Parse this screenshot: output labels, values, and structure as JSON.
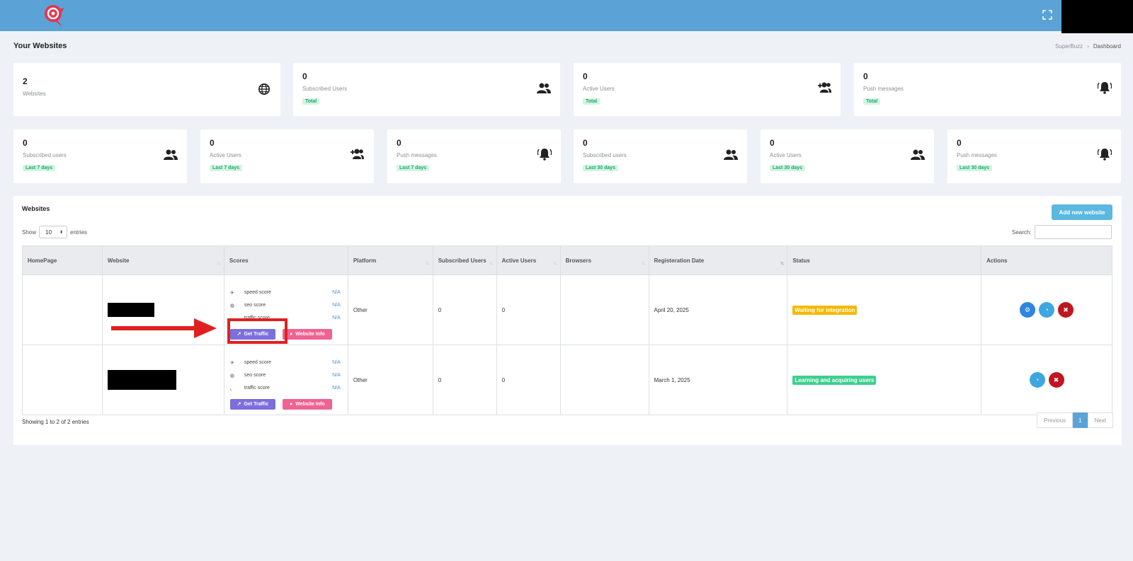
{
  "page": {
    "title": "Your Websites",
    "breadcrumb": [
      "SuperBuzz",
      "Dashboard"
    ]
  },
  "top_cards": [
    {
      "value": "2",
      "label": "Websites",
      "tag": "",
      "icon": "globe-icon"
    },
    {
      "value": "0",
      "label": "Subscribed Users",
      "tag": "Total",
      "icon": "users-icon"
    },
    {
      "value": "0",
      "label": "Active Users",
      "tag": "Total",
      "icon": "user-plus-icon"
    },
    {
      "value": "0",
      "label": "Push messages",
      "tag": "Total",
      "icon": "bell-icon"
    }
  ],
  "period_cards": [
    {
      "value": "0",
      "label": "Subscribed users",
      "tag": "Last 7 days",
      "icon": "users-icon"
    },
    {
      "value": "0",
      "label": "Active Users",
      "tag": "Last 7 days",
      "icon": "user-plus-icon"
    },
    {
      "value": "0",
      "label": "Push messages",
      "tag": "Last 7 days",
      "icon": "bell-icon"
    },
    {
      "value": "0",
      "label": "Subscribed users",
      "tag": "Last 30 days",
      "icon": "users-icon"
    },
    {
      "value": "0",
      "label": "Active Users",
      "tag": "Last 30 days",
      "icon": "users-icon"
    },
    {
      "value": "0",
      "label": "Push messages",
      "tag": "Last 30 days",
      "icon": "bell-icon"
    }
  ],
  "websites": {
    "title": "Websites",
    "add_label": "Add new website",
    "show_label": "Show",
    "entries_value": "10",
    "entries_label": "entries",
    "search_label": "Search:",
    "search_value": "",
    "columns": [
      "HomePage",
      "Website",
      "Scores",
      "Platform",
      "Subscribed Users",
      "Active Users",
      "Browsers",
      "Registeration Date",
      "Status",
      "Actions"
    ],
    "score_names": [
      "speed score",
      "seo score",
      "traffic score"
    ],
    "get_traffic_label": "Get Traffic",
    "website_info_label": "Website Info",
    "rows": [
      {
        "homepage": "",
        "scores": [
          "N/A",
          "N/A",
          "N/A"
        ],
        "platform": "Other",
        "subscribed": "0",
        "active": "0",
        "browsers": "",
        "registration": "April 20, 2025",
        "status": "Waiting for integration",
        "actions": [
          "settings-icon",
          "dashboard-icon",
          "delete-icon"
        ]
      },
      {
        "homepage": "",
        "scores": [
          "N/A",
          "N/A",
          "N/A"
        ],
        "platform": "Other",
        "subscribed": "0",
        "active": "0",
        "browsers": "",
        "registration": "March 1, 2025",
        "status": "Learning and acquiring users",
        "actions": [
          "dashboard-icon",
          "delete-icon"
        ]
      }
    ],
    "showing": "Showing 1 to 2 of 2 entries",
    "pager": {
      "prev": "Previous",
      "page": "1",
      "next": "Next"
    }
  },
  "colors": {
    "topbar": "#5ba3d6",
    "tag_green": "#20a86a",
    "status_waiting": "#f5b800",
    "status_learning": "#3ecf8e",
    "get_traffic": "#7b6fdd",
    "website_info": "#f06292",
    "annotation": "#e02020"
  }
}
